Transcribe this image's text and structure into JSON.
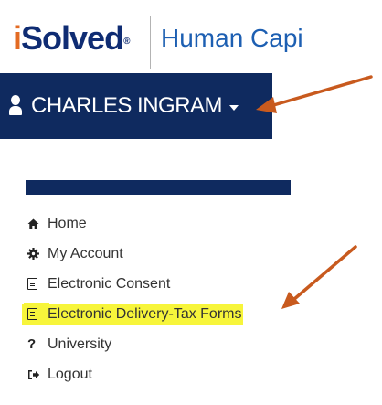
{
  "brand": {
    "logo_i": "i",
    "logo_rest": "Solved",
    "logo_mark": "®",
    "tagline": "Human Capi"
  },
  "user_bar": {
    "name": "CHARLES INGRAM"
  },
  "menu": {
    "items": [
      {
        "label": "Home",
        "icon": "home-icon"
      },
      {
        "label": "My Account",
        "icon": "gear-icon"
      },
      {
        "label": "Electronic Consent",
        "icon": "document-icon"
      },
      {
        "label": "Electronic Delivery-Tax Forms",
        "icon": "document-icon"
      },
      {
        "label": "University",
        "icon": "question-mark-icon"
      },
      {
        "label": "Logout",
        "icon": "sign-out-icon"
      }
    ]
  },
  "colors": {
    "navy": "#0f2a5f",
    "logo_orange": "#e36b23",
    "logo_blue": "#0f2c73",
    "tagline_blue": "#1d5fb2",
    "highlight_yellow": "#f7f53b",
    "arrow_orange": "#c85a1e"
  }
}
